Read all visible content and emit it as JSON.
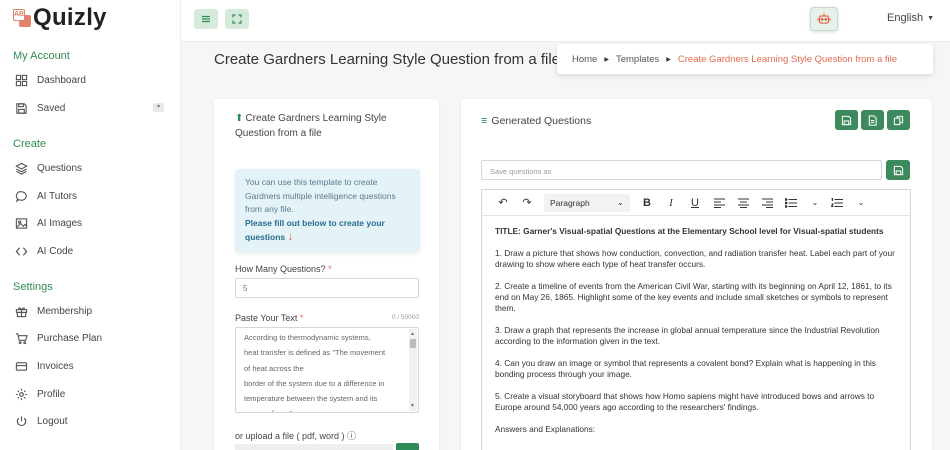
{
  "brand": {
    "name": "Quizly",
    "badge": "AB"
  },
  "sidebar": {
    "sections": [
      {
        "title": "My Account",
        "items": [
          {
            "label": "Dashboard",
            "icon": "dashboard-icon"
          },
          {
            "label": "Saved",
            "icon": "save-icon"
          }
        ]
      },
      {
        "title": "Create",
        "items": [
          {
            "label": "Questions",
            "icon": "layers-icon"
          },
          {
            "label": "AI Tutors",
            "icon": "chat-icon"
          },
          {
            "label": "AI Images",
            "icon": "image-icon"
          },
          {
            "label": "AI Code",
            "icon": "code-icon"
          }
        ]
      },
      {
        "title": "Settings",
        "items": [
          {
            "label": "Membership",
            "icon": "gift-icon"
          },
          {
            "label": "Purchase Plan",
            "icon": "cart-icon"
          },
          {
            "label": "Invoices",
            "icon": "receipt-icon"
          },
          {
            "label": "Profile",
            "icon": "gear-icon"
          },
          {
            "label": "Logout",
            "icon": "power-icon"
          }
        ]
      }
    ]
  },
  "topbar": {
    "language": "English"
  },
  "page": {
    "title": "Create Gardners Learning Style Question from a file"
  },
  "breadcrumb": {
    "home": "Home",
    "templates": "Templates",
    "current": "Create Gardners Learning Style Question from a file"
  },
  "form": {
    "title": "Create Gardners Learning Style Question from a file",
    "info_text": "You can use this template to create Gardners multiple intelligence questions from any file.",
    "info_strong": "Please fill out below to create your questions",
    "info_arrow": "↓",
    "count_label": "How Many Questions?",
    "count_value": "5",
    "text_label": "Paste Your Text",
    "text_counter": "0 / 50000",
    "text_value": "According to thermodynamic systems,\nheat transfer is defined as \"The movement\nof heat across the\nborder of the system due to a difference in\ntemperature between the system and its\nsurroundings.\"",
    "upload_label": "or upload a file ( pdf, word )"
  },
  "generated": {
    "title": "Generated Questions",
    "save_placeholder": "Save questions as",
    "paragraph_style": "Paragraph",
    "content": [
      "TITLE: Garner's Visual-spatial Questions at the Elementary School level for Visual-spatial students",
      "1. Draw a picture that shows how conduction, convection, and radiation transfer heat. Label each part of your drawing to show where each type of heat transfer occurs.",
      "2. Create a timeline of events from the American Civil War, starting with its beginning on April 12, 1861, to its end on May 26, 1865. Highlight some of the key events and include small sketches or symbols to represent them.",
      "3. Draw a graph that represents the increase in global annual temperature since the Industrial Revolution according to the information given in the text.",
      "4. Can you draw an image or symbol that represents a covalent bond? Explain what is happening in this bonding process through your image.",
      "5. Create a visual storyboard that shows how Homo sapiens might have introduced bows and arrows to Europe around 54,000 years ago according to the researchers' findings.",
      "Answers and Explanations:"
    ]
  },
  "colors": {
    "accent": "#2e8b57",
    "breadcrumb_active": "#e46a4f",
    "info_bg": "#e3f3f8"
  }
}
